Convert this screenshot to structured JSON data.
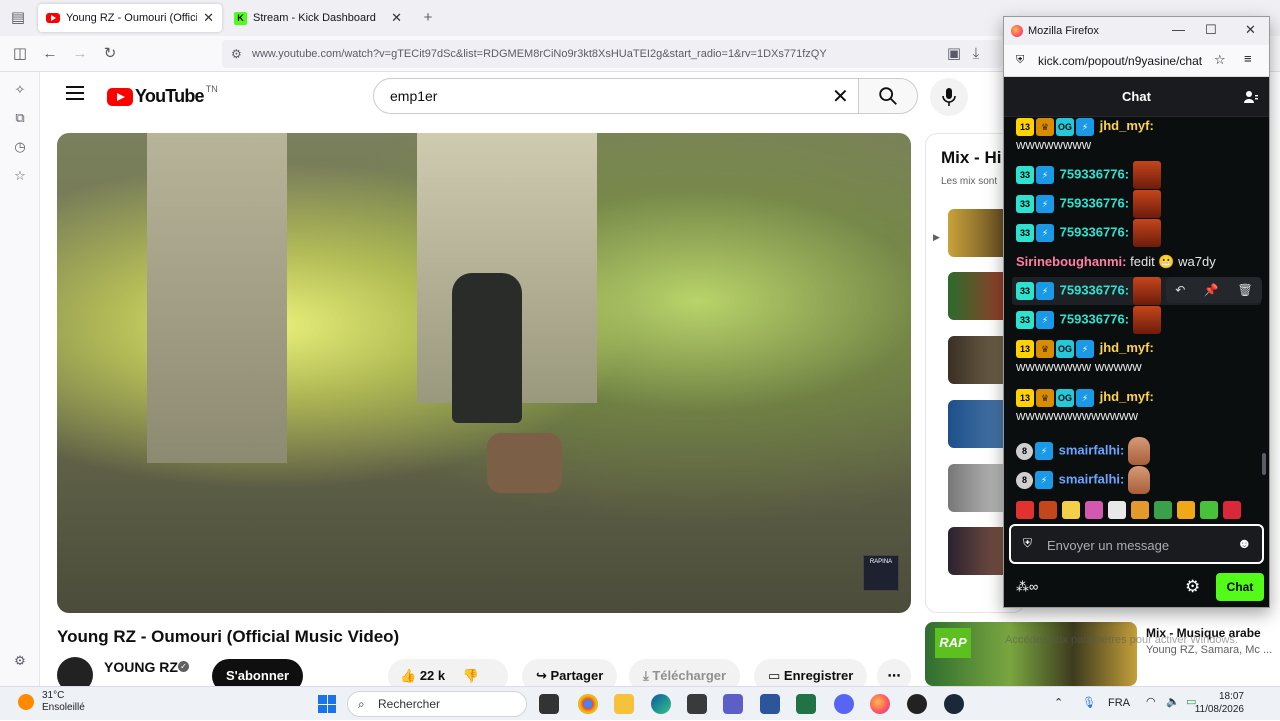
{
  "browser": {
    "tabs": [
      {
        "label": "Young RZ - Oumouri (Offici",
        "favicon": "youtube-icon"
      },
      {
        "label": "Stream - Kick Dashboard",
        "favicon": "kick-icon"
      }
    ],
    "url": "www.youtube.com/watch?v=gTECit97dSc&list=RDGMEM8rCiNo9r3kt8XsHUaTEI2g&start_radio=1&rv=1DXs771fzQY"
  },
  "youtube": {
    "logo_text": "YouTube",
    "logo_region": "TN",
    "search_value": "emp1er",
    "video_title": "Young RZ - Oumouri (Official Music Video)",
    "channel_name": "YOUNG RZ",
    "subscribe_label": "S'abonner",
    "like_count": "22 k",
    "share_label": "Partager",
    "download_label": "Télécharger",
    "save_label": "Enregistrer",
    "player_badge": "RAPINA",
    "mix_title": "Mix - Hi",
    "mix_sub": "Les mix sont",
    "recommendation": {
      "title": "Mix - Musique arabe",
      "subtitle": "Young RZ, Samara, Mc ...",
      "thumb_label": "RAP"
    },
    "activate_windows": "Accédez aux paramètres pour activer Windows."
  },
  "popout": {
    "window_title": "Mozilla Firefox",
    "url": "kick.com/popout/n9yasine/chat",
    "chat_header": "Chat",
    "messages": [
      {
        "badges": [
          "13",
          "crown",
          "og",
          "vip"
        ],
        "user": "jhd_myf",
        "text": "wwwwwwww"
      },
      {
        "badges": [
          "33",
          "vip"
        ],
        "user": "759336776",
        "text": ""
      },
      {
        "badges": [
          "33",
          "vip"
        ],
        "user": "759336776",
        "text": ""
      },
      {
        "badges": [
          "33",
          "vip"
        ],
        "user": "759336776",
        "text": ""
      },
      {
        "badges": [],
        "user": "Sirineboughanmi",
        "text": "fedit 😬 wa7dy"
      },
      {
        "badges": [
          "33",
          "vip"
        ],
        "user": "759336776",
        "text": ""
      },
      {
        "badges": [
          "33",
          "vip"
        ],
        "user": "759336776",
        "text": ""
      },
      {
        "badges": [
          "13",
          "crown",
          "og",
          "vip"
        ],
        "user": "jhd_myf",
        "text": "wwwwwwww wwwww"
      },
      {
        "badges": [
          "13",
          "crown",
          "og",
          "vip"
        ],
        "user": "jhd_myf",
        "text": "wwwwwwwwwwwww"
      },
      {
        "badges": [
          "8",
          "vip"
        ],
        "user": "smairfalhi",
        "text": ""
      },
      {
        "badges": [
          "8",
          "vip"
        ],
        "user": "smairfalhi",
        "text": ""
      }
    ],
    "input_placeholder": "Envoyer un message",
    "send_label": "Chat",
    "colors": {
      "kick_green": "#53fc18",
      "chat_bg": "#0b0e0f"
    }
  },
  "taskbar": {
    "temperature": "31°C",
    "weather": "Ensoleillé",
    "search_label": "Rechercher",
    "language": "FRA",
    "time": "18:07",
    "date": "11/08/2026"
  }
}
